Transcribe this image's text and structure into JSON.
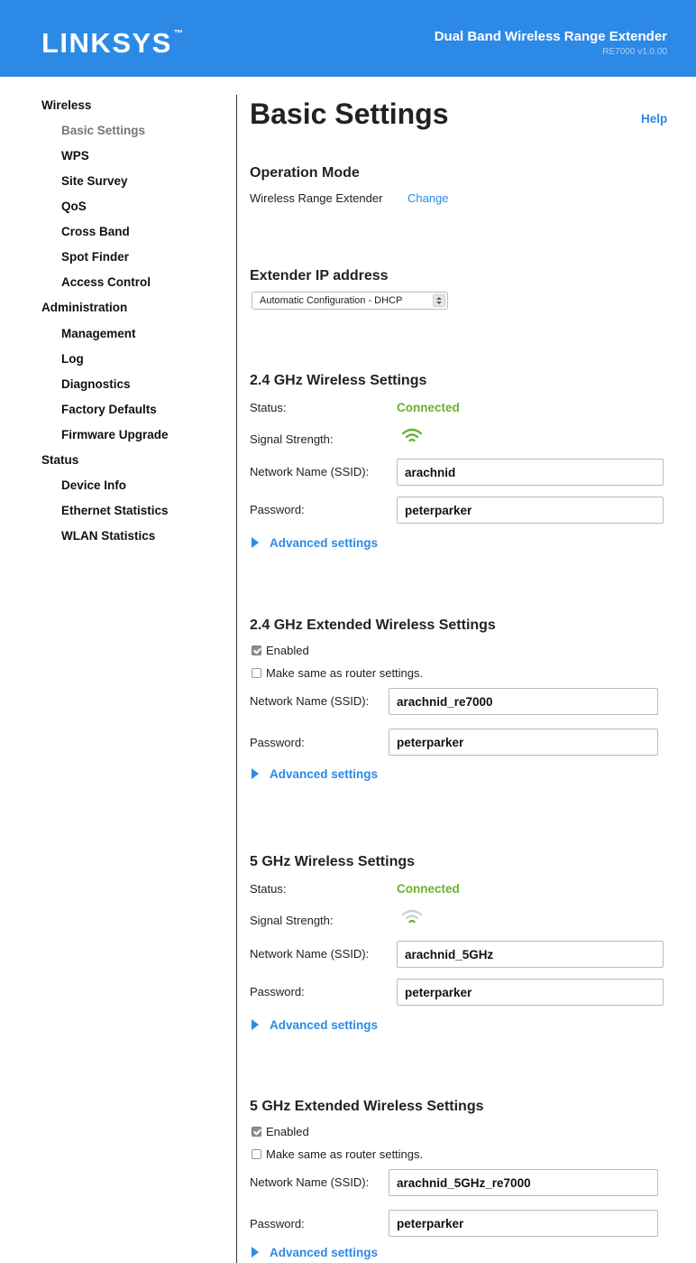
{
  "header": {
    "logo": "LINKSYS",
    "logo_tm": "™",
    "product": "Dual Band Wireless Range Extender",
    "version": "RE7000 v1.0.00"
  },
  "sidebar": {
    "groups": [
      {
        "label": "Wireless",
        "items": [
          "Basic Settings",
          "WPS",
          "Site Survey",
          "QoS",
          "Cross Band",
          "Spot Finder",
          "Access Control"
        ]
      },
      {
        "label": "Administration",
        "items": [
          "Management",
          "Log",
          "Diagnostics",
          "Factory Defaults",
          "Firmware Upgrade"
        ]
      },
      {
        "label": "Status",
        "items": [
          "Device Info",
          "Ethernet Statistics",
          "WLAN Statistics"
        ]
      }
    ],
    "active_item": "Basic Settings"
  },
  "page": {
    "title": "Basic Settings",
    "help": "Help"
  },
  "operation_mode": {
    "heading": "Operation Mode",
    "value": "Wireless Range Extender",
    "change": "Change"
  },
  "extender_ip": {
    "heading": "Extender IP address",
    "selected": "Automatic Configuration - DHCP"
  },
  "w24": {
    "heading": "2.4 GHz Wireless Settings",
    "status_label": "Status:",
    "status_value": "Connected",
    "signal_label": "Signal Strength:",
    "signal_level": 3,
    "ssid_label": "Network Name (SSID):",
    "ssid": "arachnid",
    "password_label": "Password:",
    "password": "peterparker",
    "advanced": "Advanced settings"
  },
  "ext24": {
    "heading": "2.4 GHz Extended Wireless Settings",
    "enabled_label": "Enabled",
    "enabled": true,
    "same_label": "Make same as router settings.",
    "same": false,
    "ssid_label": "Network Name (SSID):",
    "ssid": "arachnid_re7000",
    "password_label": "Password:",
    "password": "peterparker",
    "advanced": "Advanced settings"
  },
  "w5": {
    "heading": "5 GHz Wireless Settings",
    "status_label": "Status:",
    "status_value": "Connected",
    "signal_label": "Signal Strength:",
    "signal_level": 1,
    "ssid_label": "Network Name (SSID):",
    "ssid": "arachnid_5GHz",
    "password_label": "Password:",
    "password": "peterparker",
    "advanced": "Advanced settings"
  },
  "ext5": {
    "heading": "5 GHz Extended Wireless Settings",
    "enabled_label": "Enabled",
    "enabled": true,
    "same_label": "Make same as router settings.",
    "same": false,
    "ssid_label": "Network Name (SSID):",
    "ssid": "arachnid_5GHz_re7000",
    "password_label": "Password:",
    "password": "peterparker",
    "advanced": "Advanced settings"
  },
  "colors": {
    "brand": "#2c8ae6",
    "connected": "#68b22e",
    "wifi_inactive": "#cfcfcf"
  }
}
